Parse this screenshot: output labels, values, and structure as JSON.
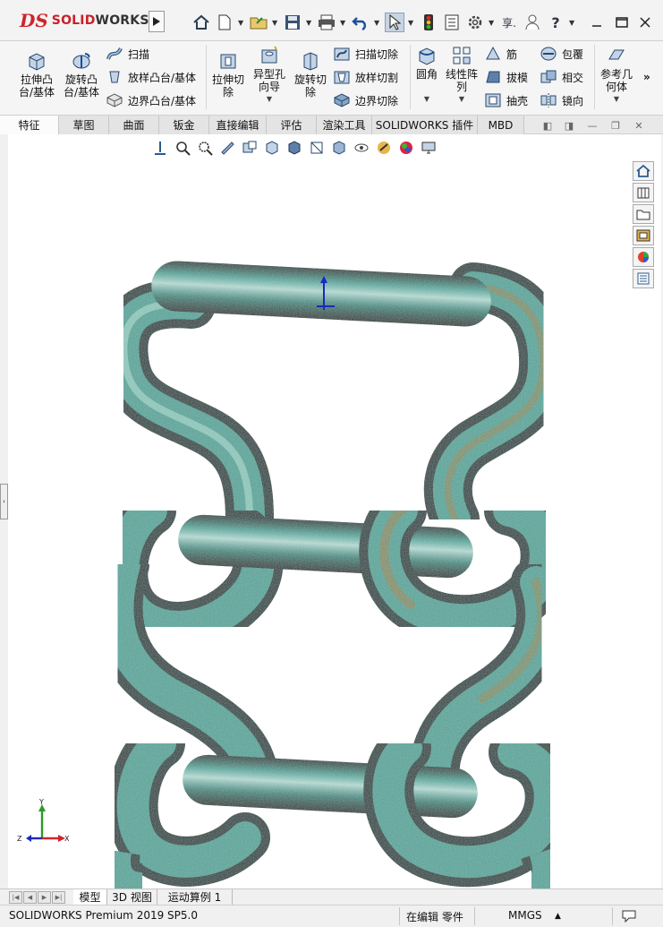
{
  "title_bar": {
    "brand_prefix": "SOLID",
    "brand_suffix": "WORKS",
    "ds_mark": "DS",
    "user_label": "享.",
    "help_label": "?"
  },
  "ribbon": {
    "extrude_boss": "拉伸凸\n台/基体",
    "revolve_boss": "旋转凸\n台/基体",
    "sweep": "扫描",
    "loft_boss": "放样凸台/基体",
    "boundary_boss": "边界凸台/基体",
    "extrude_cut": "拉伸切\n除",
    "hole_wizard": "异型孔\n向导",
    "revolve_cut": "旋转切\n除",
    "sweep_cut": "扫描切除",
    "loft_cut": "放样切割",
    "boundary_cut": "边界切除",
    "fillet": "圆角",
    "linear_pattern": "线性阵\n列",
    "rib": "筋",
    "draft": "拔模",
    "shell": "抽壳",
    "wrap": "包覆",
    "intersect": "相交",
    "mirror": "镜向",
    "reference_geometry": "参考几\n何体",
    "more": "»"
  },
  "tabs": [
    {
      "label": "特征",
      "active": true
    },
    {
      "label": "草图",
      "active": false
    },
    {
      "label": "曲面",
      "active": false
    },
    {
      "label": "钣金",
      "active": false
    },
    {
      "label": "直接编辑",
      "active": false
    },
    {
      "label": "评估",
      "active": false
    },
    {
      "label": "渲染工具",
      "active": false
    },
    {
      "label": "SOLIDWORKS 插件",
      "active": false
    },
    {
      "label": "MBD",
      "active": false
    }
  ],
  "triad": {
    "x": "X",
    "y": "Y",
    "z": "Z"
  },
  "bottom_tabs": [
    {
      "label": "模型",
      "active": true
    },
    {
      "label": "3D 视图",
      "active": false
    },
    {
      "label": "运动算例 1",
      "active": false
    }
  ],
  "status": {
    "product": "SOLIDWORKS Premium 2019 SP5.0",
    "mode": "在编辑 零件",
    "units": "MMGS",
    "units_arrow": "▲"
  },
  "colors": {
    "chain_teal": "#4fa79b",
    "chain_dark": "#1f3e3a",
    "chain_bronze": "#a8864a",
    "accent_red": "#c9202a"
  }
}
